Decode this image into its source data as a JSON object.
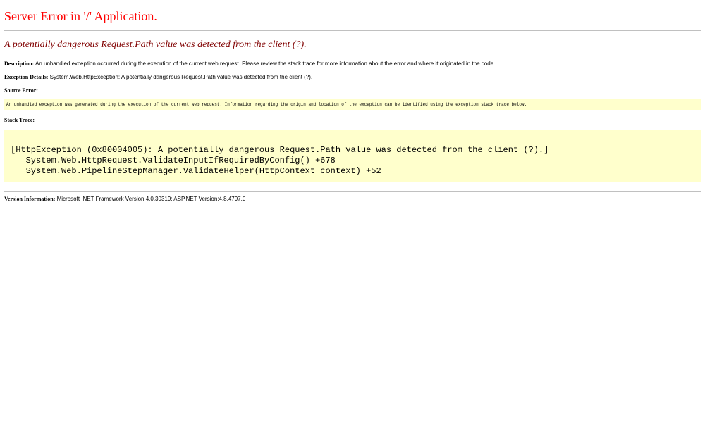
{
  "page": {
    "title": "Server Error in '/' Application.",
    "subtitle": "A potentially dangerous Request.Path value was detected from the client (?)."
  },
  "description": {
    "label": "Description:",
    "text": "An unhandled exception occurred during the execution of the current web request. Please review the stack trace for more information about the error and where it originated in the code."
  },
  "exception_details": {
    "label": "Exception Details:",
    "text": "System.Web.HttpException: A potentially dangerous Request.Path value was detected from the client (?)."
  },
  "source_error": {
    "label": "Source Error:",
    "text": "An unhandled exception was generated during the execution of the current web request. Information regarding the origin and location of the exception can be identified using the exception stack trace below."
  },
  "stack_trace": {
    "label": "Stack Trace:",
    "text": "[HttpException (0x80004005): A potentially dangerous Request.Path value was detected from the client (?).]\n   System.Web.HttpRequest.ValidateInputIfRequiredByConfig() +678\n   System.Web.PipelineStepManager.ValidateHelper(HttpContext context) +52"
  },
  "version_information": {
    "label": "Version Information:",
    "text": "Microsoft .NET Framework Version:4.0.30319; ASP.NET Version:4.8.4797.0"
  },
  "colors": {
    "title": "#ff0000",
    "subtitle": "#800000",
    "code_background": "#ffffcc",
    "rule": "#c0c0c0"
  }
}
